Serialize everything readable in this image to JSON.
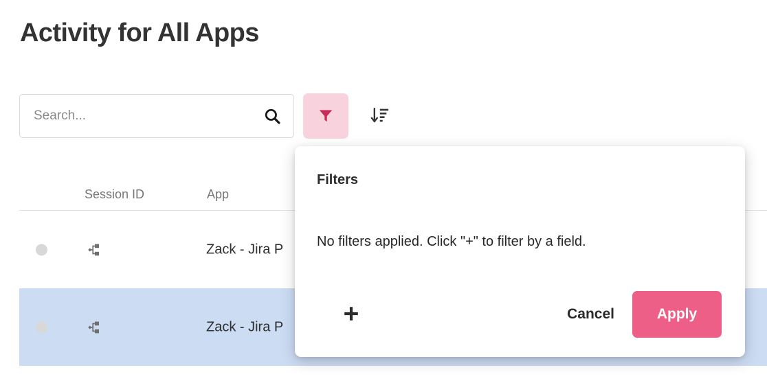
{
  "page": {
    "title": "Activity for All Apps"
  },
  "toolbar": {
    "search": {
      "placeholder": "Search...",
      "value": "",
      "icon": "search-icon"
    },
    "filter_button": {
      "icon": "funnel-icon",
      "active": true,
      "background_color": "#f8d3de",
      "icon_color": "#c92b5c"
    },
    "sort_button": {
      "icon": "sort-descending-icon",
      "icon_color": "#333333"
    }
  },
  "table": {
    "columns": [
      {
        "key": "status",
        "label": ""
      },
      {
        "key": "session_id",
        "label": "Session ID"
      },
      {
        "key": "app",
        "label": "App"
      }
    ],
    "rows": [
      {
        "status_color": "#d8d8d8",
        "session_icon": "hierarchy-icon",
        "app": "Zack - Jira P",
        "selected": false
      },
      {
        "status_color": "#d8d8d8",
        "session_icon": "hierarchy-icon",
        "app": "Zack - Jira P",
        "selected": true
      }
    ],
    "selected_row_color": "#ccdcf3"
  },
  "filters_dialog": {
    "title": "Filters",
    "empty_message": "No filters applied. Click \"+\" to filter by a field.",
    "add_label": "+",
    "cancel_label": "Cancel",
    "apply_label": "Apply",
    "apply_color": "#ee5f87"
  }
}
